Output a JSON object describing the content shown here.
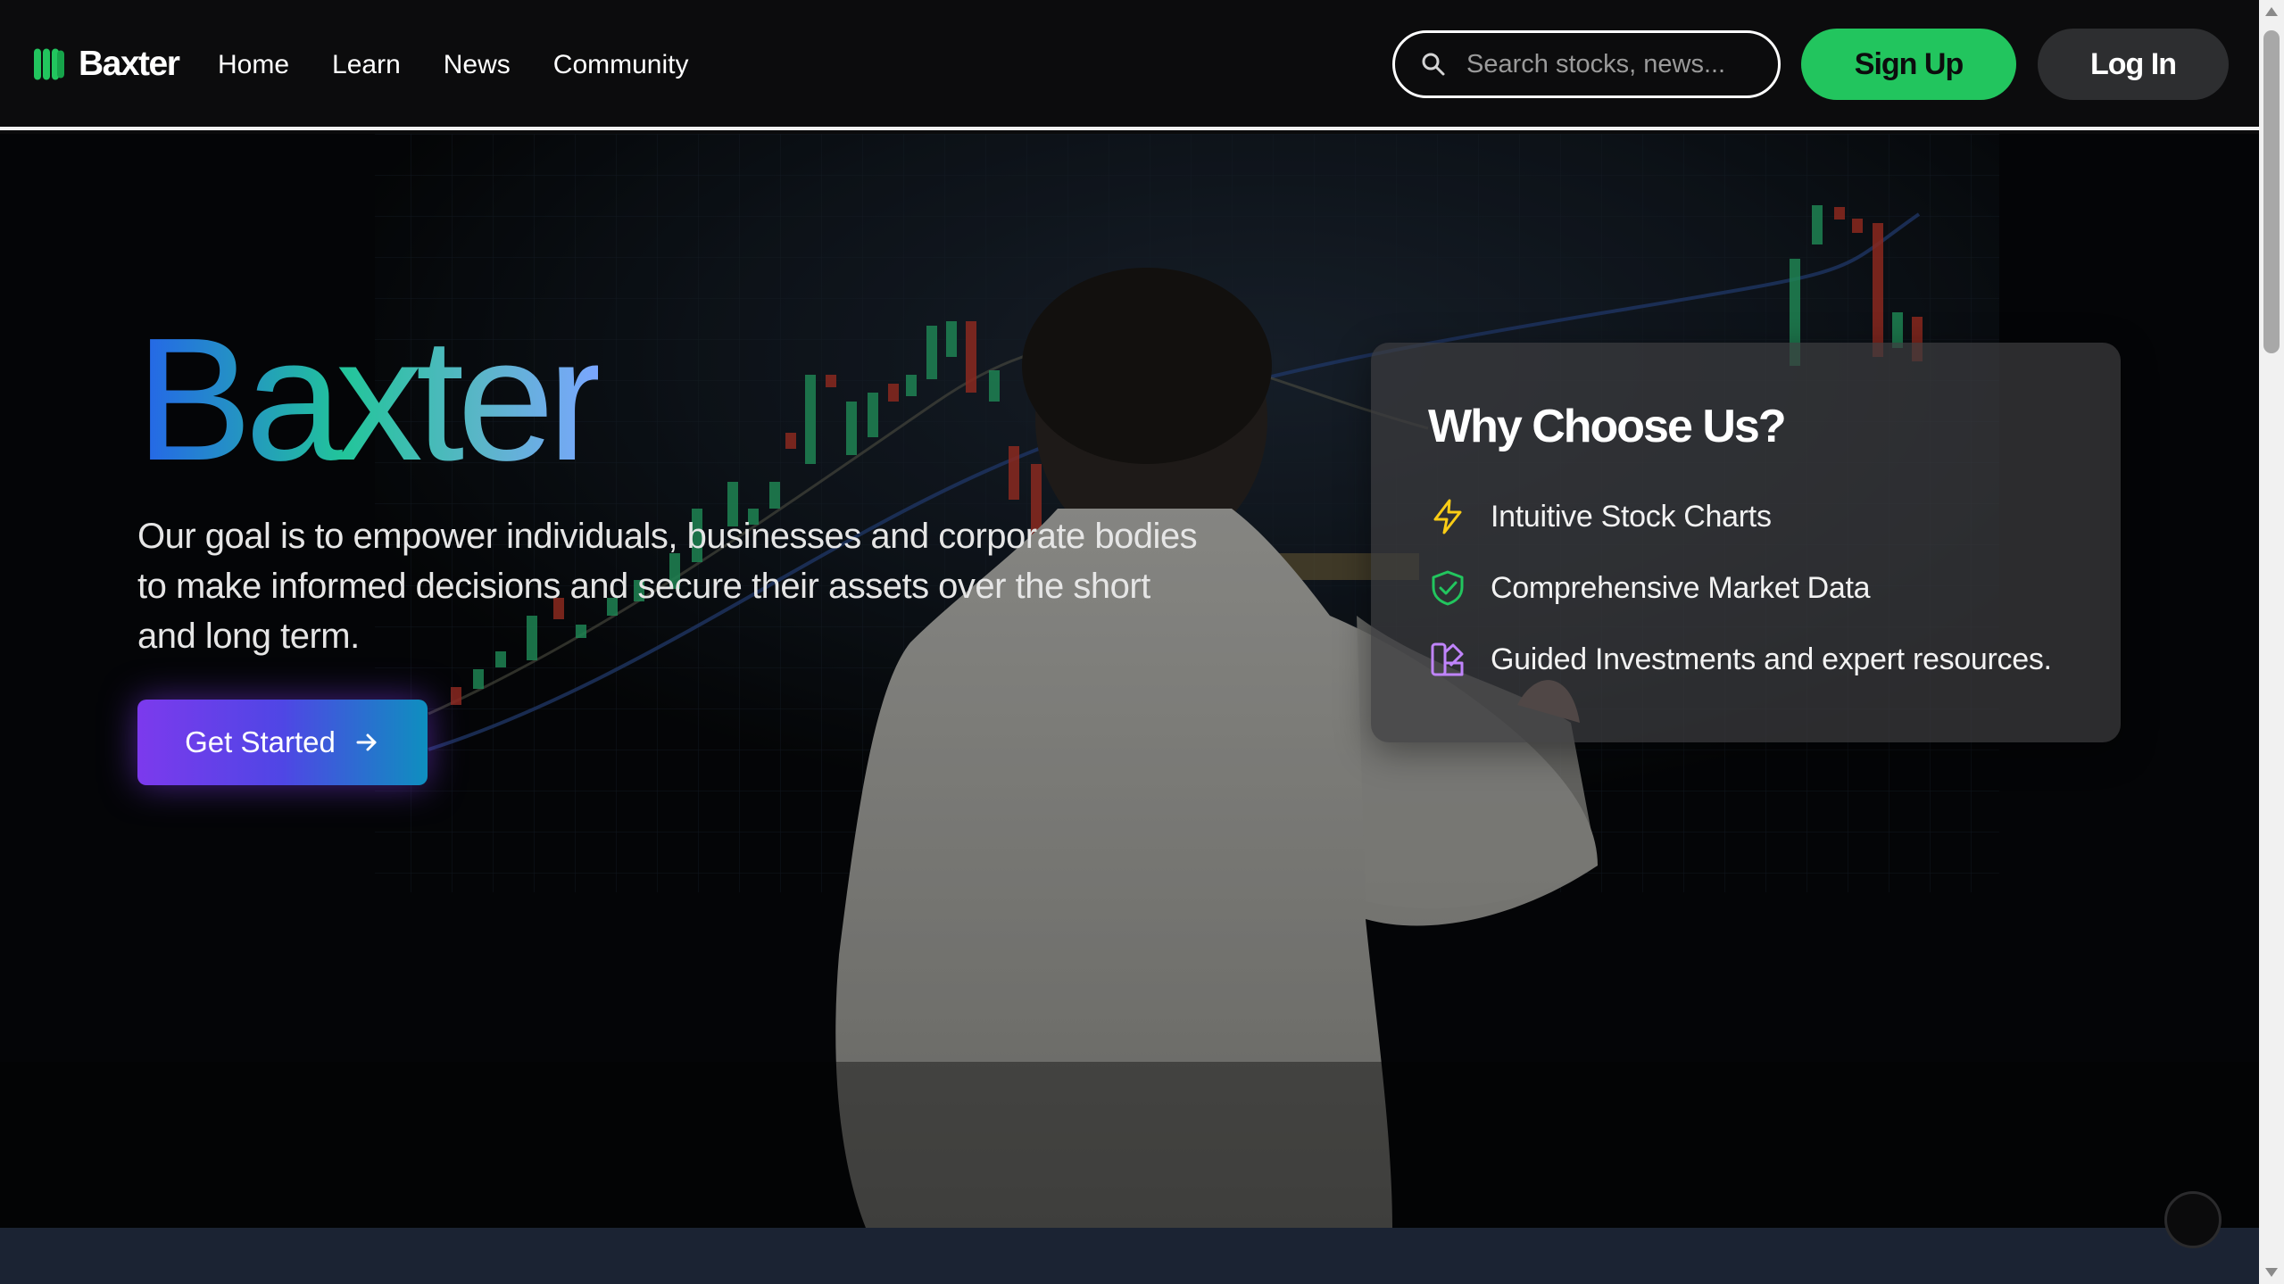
{
  "navbar": {
    "brand": "Baxter",
    "links": [
      {
        "label": "Home"
      },
      {
        "label": "Learn"
      },
      {
        "label": "News"
      },
      {
        "label": "Community"
      }
    ],
    "search_placeholder": "Search stocks, news...",
    "signup_label": "Sign Up",
    "login_label": "Log In"
  },
  "hero": {
    "title": "Baxter",
    "description": "Our goal is to empower individuals, businesses and corporate bodies to make informed decisions and secure their assets over the short and long term.",
    "cta_label": "Get Started"
  },
  "why": {
    "title": "Why Choose Us?",
    "items": [
      {
        "label": "Intuitive Stock Charts",
        "icon": "lightning-icon",
        "color": "#facc15"
      },
      {
        "label": "Comprehensive Market Data",
        "icon": "shield-check-icon",
        "color": "#22c55e"
      },
      {
        "label": "Guided Investments and expert resources.",
        "icon": "swatch-book-icon",
        "color": "#c084fc"
      }
    ]
  },
  "colors": {
    "accent_green": "#22c55e",
    "cta_gradient_start": "#7c3aed",
    "cta_gradient_end": "#0e8fbf",
    "footer_strip": "#1b2333"
  }
}
